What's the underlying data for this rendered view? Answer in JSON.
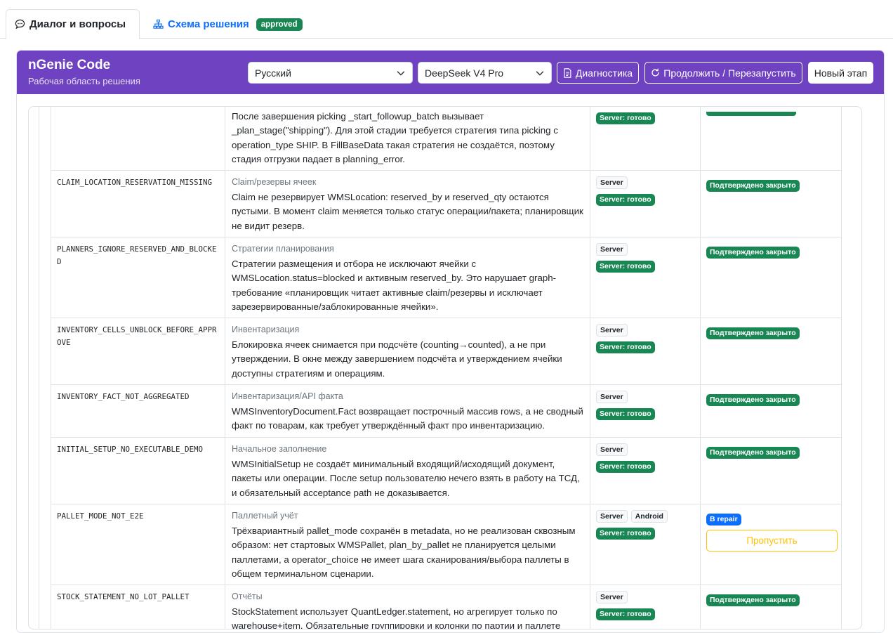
{
  "tabs": [
    {
      "label": "Диалог и вопросы",
      "icon": "chat-icon",
      "active": true
    },
    {
      "label": "Схема решения",
      "icon": "hierarchy-icon",
      "active": false,
      "badge": "approved"
    }
  ],
  "header": {
    "title": "nGenie Code",
    "subtitle": "Рабочая область решения",
    "language": "Русский",
    "model": "DeepSeek V4 Pro",
    "diagnostics_label": "Диагностика",
    "continue_label": "Продолжить / Перезапустить",
    "new_stage_label": "Новый этап"
  },
  "colors": {
    "accent": "#6f42c1",
    "success": "#198754",
    "primary": "#0d6efd",
    "warning": "#ffc107"
  },
  "rows": [
    {
      "code": "",
      "category": "",
      "description": "После завершения picking _start_followup_batch вызывает _plan_stage(\"shipping\"). Для этой стадии требуется стратегия типа picking с operation_type SHIP. В FillBaseData такая стратегия не создаётся, поэтому стадия отгрузки падает в planning_error.",
      "platforms": [],
      "server_status": "Server: готово",
      "status": ""
    },
    {
      "code": "CLAIM_LOCATION_RESERVATION_MISSING",
      "category": "Claim/резервы ячеек",
      "description": "Claim не резервирует WMSLocation: reserved_by и reserved_qty остаются пустыми. В момент claim меняется только статус операции/пакета; планировщик не видит резерв.",
      "platforms": [
        "Server"
      ],
      "server_status": "Server: готово",
      "status": "Подтверждено закрыто"
    },
    {
      "code": "PLANNERS_IGNORE_RESERVED_AND_BLOCKED",
      "category": "Стратегии планирования",
      "description": "Стратегии размещения и отбора не исключают ячейки с WMSLocation.status=blocked и активным reserved_by. Это нарушает graph-требование «планировщик читает активные claim/резервы и исключает зарезервированные/заблокированные ячейки».",
      "platforms": [
        "Server"
      ],
      "server_status": "Server: готово",
      "status": "Подтверждено закрыто"
    },
    {
      "code": "INVENTORY_CELLS_UNBLOCK_BEFORE_APPROVE",
      "category": "Инвентаризация",
      "description": "Блокировка ячеек снимается при подсчёте (counting→counted), а не при утверждении. В окне между завершением подсчёта и утверждением ячейки доступны стратегиям и операциям.",
      "platforms": [
        "Server"
      ],
      "server_status": "Server: готово",
      "status": "Подтверждено закрыто"
    },
    {
      "code": "INVENTORY_FACT_NOT_AGGREGATED",
      "category": "Инвентаризация/API факта",
      "description": "WMSInventoryDocument.Fact возвращает построчный массив rows, а не сводный факт по товарам, как требует утверждённый факт про инвентаризацию.",
      "platforms": [
        "Server"
      ],
      "server_status": "Server: готово",
      "status": "Подтверждено закрыто"
    },
    {
      "code": "INITIAL_SETUP_NO_EXECUTABLE_DEMO",
      "category": "Начальное заполнение",
      "description": "WMSInitialSetup не создаёт минимальный входящий/исходящий документ, пакеты или операции. После setup пользователю нечего взять в работу на ТСД, и обязательный acceptance path не доказывается.",
      "platforms": [
        "Server"
      ],
      "server_status": "Server: готово",
      "status": "Подтверждено закрыто"
    },
    {
      "code": "PALLET_MODE_NOT_E2E",
      "category": "Паллетный учёт",
      "description": "Трёхвариантный pallet_mode сохранён в metadata, но не реализован сквозным образом: нет стартовых WMSPallet, plan_by_pallet не планируется целыми паллетами, а operator_choice не имеет шага сканирования/выбора паллеты в общем терминальном сценарии.",
      "platforms": [
        "Server",
        "Android"
      ],
      "server_status": "Server: готово",
      "status": "B repair",
      "action_label": "Пропустить"
    },
    {
      "code": "STOCK_STATEMENT_NO_LOT_PALLET",
      "category": "Отчёты",
      "description": "StockStatement использует QuantLedger.statement, но агрегирует только по warehouse+item. Обязательные группировки и колонки по партии и паллете",
      "platforms": [
        "Server"
      ],
      "server_status": "Server: готово",
      "status": "Подтверждено закрыто"
    }
  ]
}
